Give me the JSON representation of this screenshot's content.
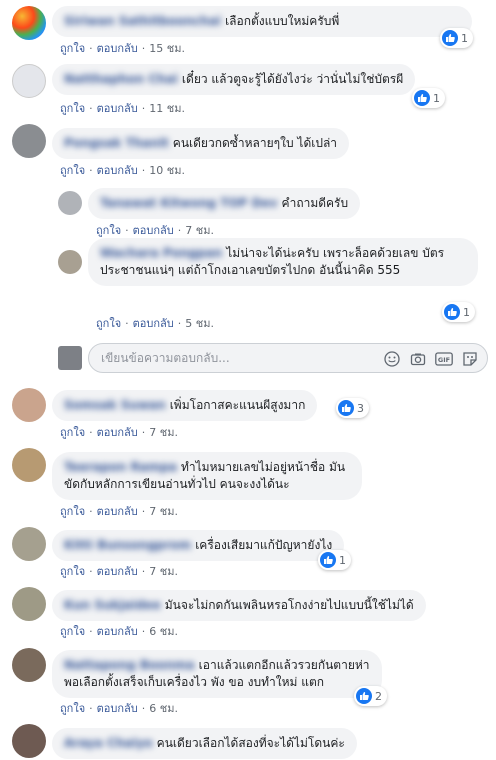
{
  "comments": [
    {
      "id": "c1",
      "name": "Siriwan Sathitboonchai",
      "text": "เลือกตั้งแบบใหม่ครับพี่",
      "like_label": "ถูกใจ",
      "reply_label": "ตอบกลับ",
      "time": "15 ชม.",
      "reactions": "1"
    },
    {
      "id": "c2",
      "name": "Natthaphon Chai",
      "text": "เดี๋ยว แล้วตูจะรู้ได้ยังไงว่ะ ว่านั่นไม่ใช่บัตรผี",
      "like_label": "ถูกใจ",
      "reply_label": "ตอบกลับ",
      "time": "11 ชม.",
      "reactions": "1"
    },
    {
      "id": "c3",
      "name": "Pongsak Thanit",
      "text": "คนเดียวกดซ้ำหลายๆใบ ได้เปล่า",
      "like_label": "ถูกใจ",
      "reply_label": "ตอบกลับ",
      "time": "10 ชม."
    },
    {
      "id": "r1",
      "name": "Tanawat Kitwong TOP Dev",
      "text": "คำถามดีครับ",
      "like_label": "ถูกใจ",
      "reply_label": "ตอบกลับ",
      "time": "7 ชม."
    },
    {
      "id": "r2",
      "name": "Wachara Pongpan",
      "text": "ไม่น่าจะได้น่ะครับ เพราะล็อคด้วยเลข บัตรประชาชนแน่ๆ แต่ถ้าโกงเอาเลขบัตรไปกด อันนี้น่าคิด 555",
      "like_label": "ถูกใจ",
      "reply_label": "ตอบกลับ",
      "time": "5 ชม.",
      "reactions": "1"
    },
    {
      "id": "c4",
      "name": "Somsak Suwan",
      "text": "เพิ่มโอกาสคะแนนผีสูงมาก",
      "like_label": "ถูกใจ",
      "reply_label": "ตอบกลับ",
      "time": "7 ชม.",
      "reactions": "3"
    },
    {
      "id": "c5",
      "name": "Teerapon Rampa",
      "text": "ทำไมหมายเลขไม่อยู่หน้าชื่อ มันขัดกับหลักการเขียนอ่านทั่วไป คนจะงงได้นะ",
      "like_label": "ถูกใจ",
      "reply_label": "ตอบกลับ",
      "time": "7 ชม."
    },
    {
      "id": "c6",
      "name": "Kitti Bunsongprom",
      "text": "เครื่องเสียมาแก้ปัญหายังไง",
      "like_label": "ถูกใจ",
      "reply_label": "ตอบกลับ",
      "time": "7 ชม.",
      "reactions": "1"
    },
    {
      "id": "c7",
      "name": "Kun Sukjaidee",
      "text": "มันจะไม่กดกันเพลินหรอโกงง่ายไปแบบนี้ใช้ไม่ได้",
      "like_label": "ถูกใจ",
      "reply_label": "ตอบกลับ",
      "time": "6 ชม."
    },
    {
      "id": "c8",
      "name": "Nattapong Boonma",
      "text": "เอาแล้วแตกอีกแล้วรวยกันตายห่า พอเลือกตั้งเสร็จเก็บเครื่องไว พัง ขอ งบทำใหม่ แตก",
      "like_label": "ถูกใจ",
      "reply_label": "ตอบกลับ",
      "time": "6 ชม.",
      "reactions": "2"
    },
    {
      "id": "c9",
      "name": "Araya Chaiyo",
      "text": "คนเดียวเลือกได้สองที่จะได้ไม่โดนค่ะ"
    }
  ],
  "reply_input": {
    "placeholder": "เขียนข้อความตอบกลับ..."
  },
  "icons": [
    "like-icon",
    "emoji-icon",
    "camera-icon",
    "gif-icon",
    "sticker-icon"
  ],
  "colors": {
    "name": "#385898",
    "bubble": "#f2f3f5",
    "like": "#1877f2",
    "meta": "#606770"
  }
}
